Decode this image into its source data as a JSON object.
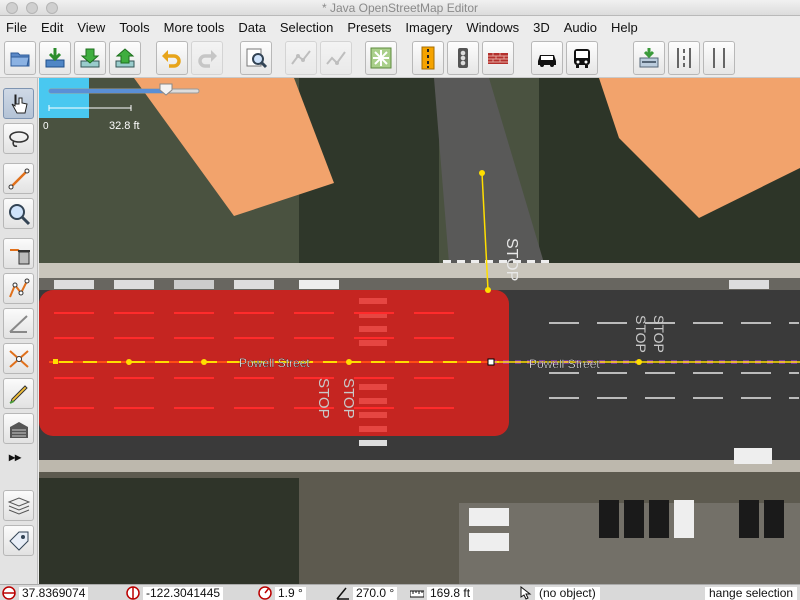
{
  "window": {
    "title": "* Java OpenStreetMap Editor"
  },
  "menubar": {
    "items": [
      {
        "label": "File"
      },
      {
        "label": "Edit"
      },
      {
        "label": "View"
      },
      {
        "label": "Tools"
      },
      {
        "label": "More tools"
      },
      {
        "label": "Data"
      },
      {
        "label": "Selection"
      },
      {
        "label": "Presets"
      },
      {
        "label": "Imagery"
      },
      {
        "label": "Windows"
      },
      {
        "label": "3D"
      },
      {
        "label": "Audio"
      },
      {
        "label": "Help"
      }
    ]
  },
  "toolbar": {
    "icons": [
      "open-file-icon",
      "download-icon",
      "download-data-icon",
      "upload-icon",
      "undo-icon",
      "redo-icon",
      "zoom-search-icon",
      "wireframe-icon",
      "wireframe-alt-icon",
      "preset-group-icon",
      "road-preset-icon",
      "traffic-signal-icon",
      "barrier-icon",
      "car-icon",
      "bus-icon",
      "map-paint-icon",
      "lane-single-icon",
      "lane-double-icon"
    ]
  },
  "sidebar": {
    "tools": [
      "select-tool-icon",
      "lasso-tool-icon",
      "draw-tool-icon",
      "zoom-tool-icon",
      "delete-tool-icon",
      "improve-way-icon",
      "parallel-tool-icon",
      "split-tool-icon",
      "pencil-tool-icon",
      "building-tool-icon"
    ],
    "more_label": "▸▸",
    "toggle_icons": [
      "layers-toggle-icon",
      "tag-toggle-icon"
    ]
  },
  "map": {
    "zoom_slider_value": 0.78,
    "scale_label": "32.8 ft",
    "street_labels": [
      "Powell Street",
      "Powell Street"
    ],
    "road_markings": [
      "STOP",
      "STOP",
      "STOP",
      "STOP",
      "STOP"
    ],
    "highlight_color": "#e8201c",
    "way_color": "#ffde00",
    "route_color": "#ad3af0"
  },
  "status": {
    "lat": "37.8369074",
    "lon": "-122.3041445",
    "heading": "1.9 °",
    "angle": "270.0 °",
    "distance": "169.8 ft",
    "object": "(no object)",
    "help": "hange selection"
  }
}
